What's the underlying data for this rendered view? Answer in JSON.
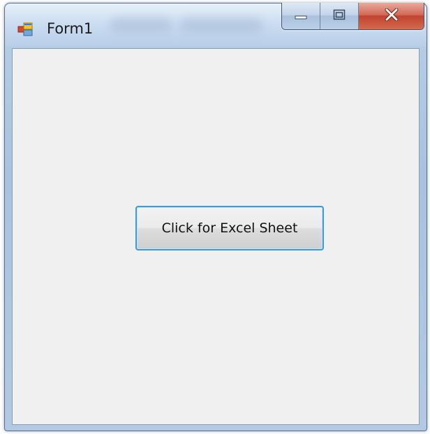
{
  "window": {
    "title": "Form1",
    "icon": "winforms-app-icon"
  },
  "caption_buttons": {
    "minimize_icon": "minimize-icon",
    "maximize_icon": "maximize-icon",
    "close_icon": "close-icon"
  },
  "form": {
    "button_label": "Click for Excel Sheet"
  },
  "colors": {
    "client_background": "#f0f0f0",
    "button_border_focus": "#3c9ad6",
    "close_button": "#c04431"
  }
}
